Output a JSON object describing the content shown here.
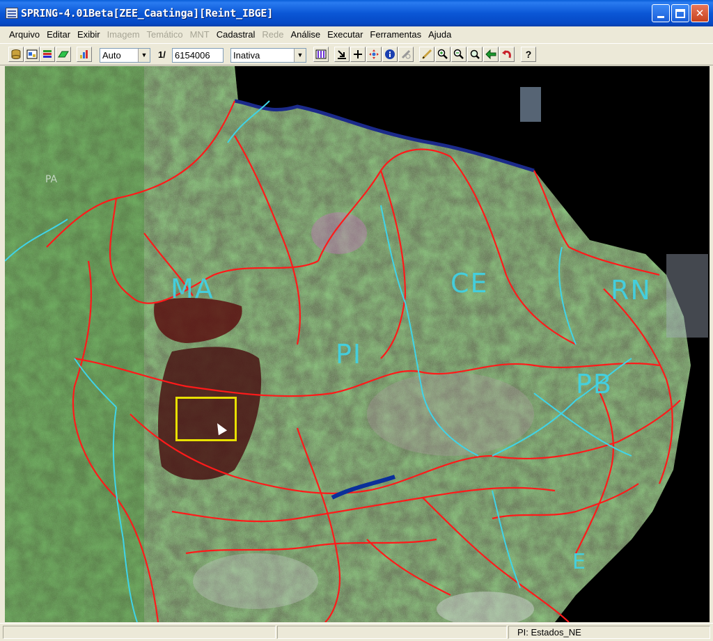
{
  "window": {
    "title": "SPRING-4.01Beta[ZEE_Caatinga][Reint_IBGE]"
  },
  "menu": [
    {
      "label": "Arquivo",
      "enabled": true
    },
    {
      "label": "Editar",
      "enabled": true
    },
    {
      "label": "Exibir",
      "enabled": true
    },
    {
      "label": "Imagem",
      "enabled": false
    },
    {
      "label": "Temático",
      "enabled": false
    },
    {
      "label": "MNT",
      "enabled": false
    },
    {
      "label": "Cadastral",
      "enabled": true
    },
    {
      "label": "Rede",
      "enabled": false
    },
    {
      "label": "Análise",
      "enabled": true
    },
    {
      "label": "Executar",
      "enabled": true
    },
    {
      "label": "Ferramentas",
      "enabled": true
    },
    {
      "label": "Ajuda",
      "enabled": true
    }
  ],
  "toolbar": {
    "zoom_mode": "Auto",
    "scale_prefix": "1/",
    "scale_value": "6154006",
    "mode_select": "Inativa",
    "icons": [
      "database-icon",
      "layers-panel-icon",
      "color-layers-icon",
      "green-plane-icon",
      "chart-icon",
      "palette-icon",
      "import-icon",
      "crosshair-icon",
      "pan-icon",
      "info-icon",
      "measure-icon",
      "draw-line-icon",
      "zoom-in-icon",
      "zoom-out-icon",
      "zoom-window-icon",
      "back-arrow-icon",
      "undo-icon",
      "help-icon"
    ]
  },
  "map": {
    "state_labels": [
      "MA",
      "PI",
      "CE",
      "RN",
      "PB",
      "E"
    ],
    "region_label": "PA",
    "colors": {
      "boundaries": "#ff1a1a",
      "rivers": "#3fd4e8",
      "selection": "#e8e000",
      "background": "#000000"
    }
  },
  "status": {
    "plane_info": "PI: Estados_NE"
  }
}
